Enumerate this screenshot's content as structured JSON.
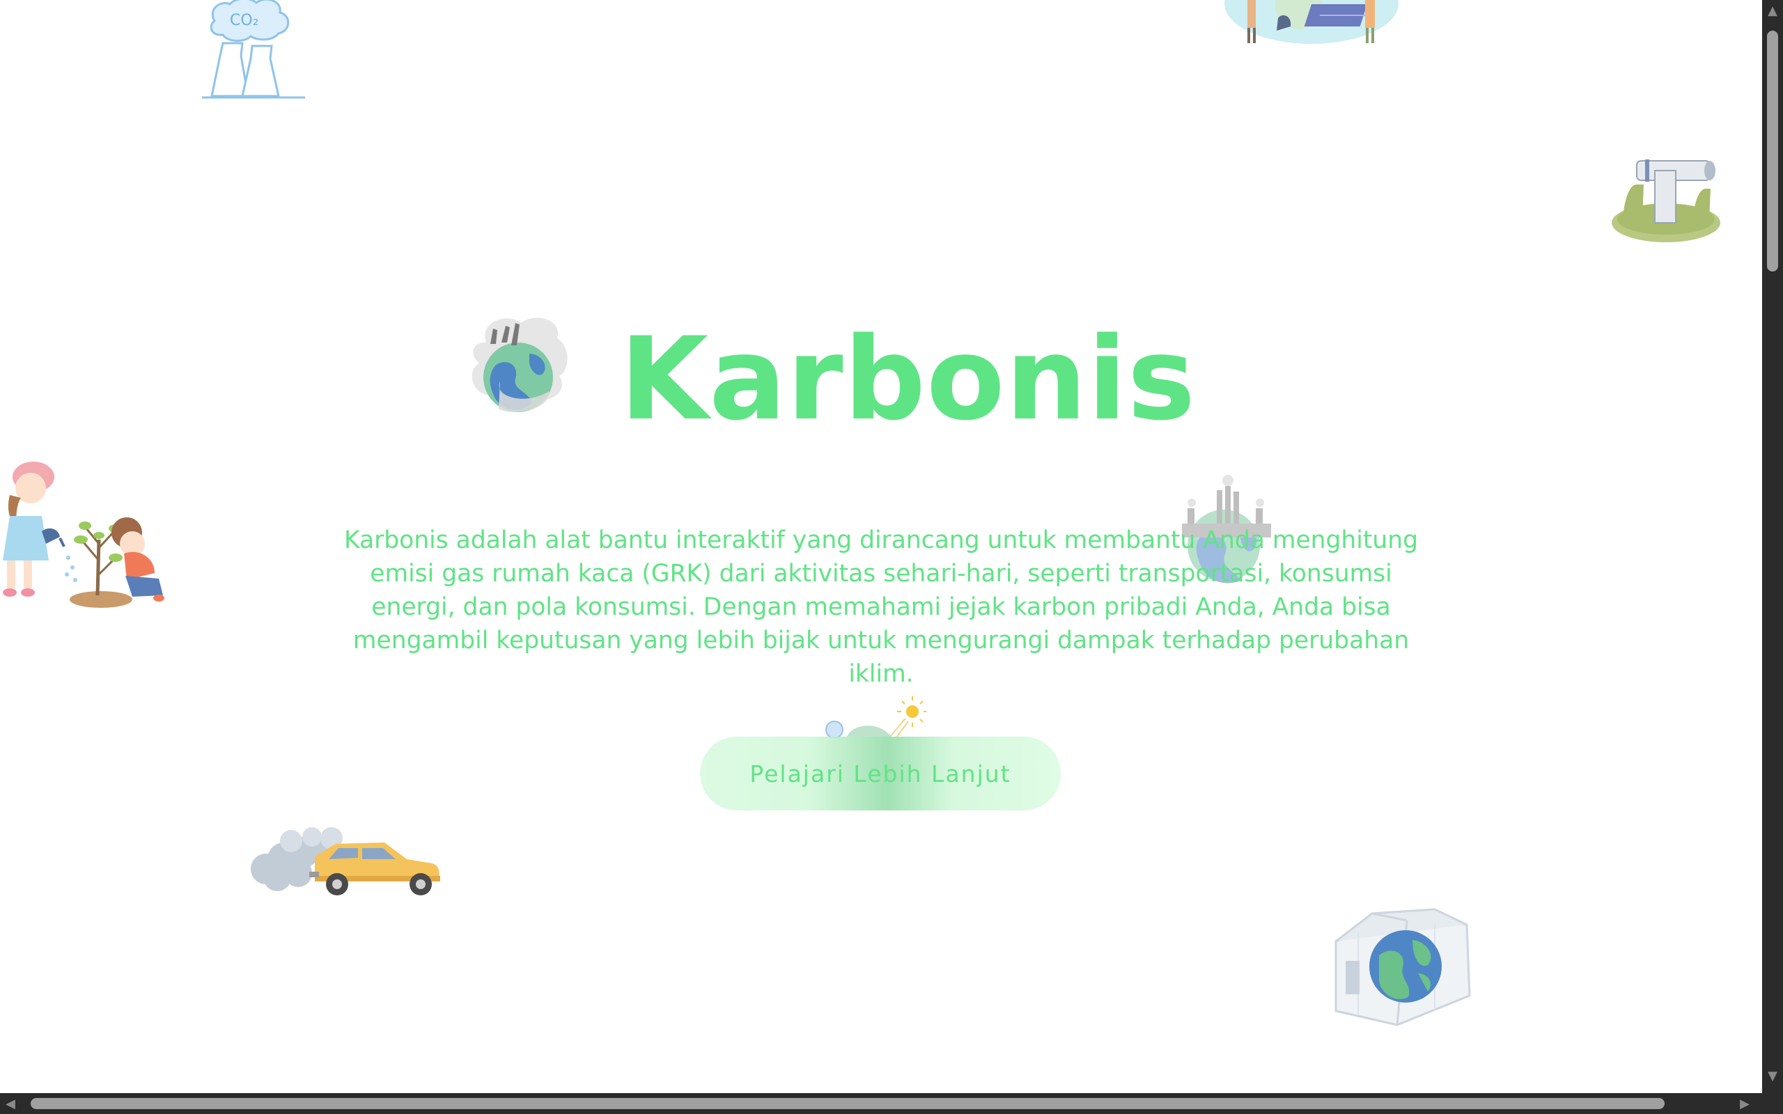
{
  "hero": {
    "title": "Karbonis",
    "description": "Karbonis adalah alat bantu interaktif yang dirancang untuk membantu Anda menghitung emisi gas rumah kaca (GRK) dari aktivitas sehari-hari, seperti transportasi, konsumsi energi, dan pola konsumsi. Dengan memahami jejak karbon pribadi Anda, Anda bisa mengambil keputusan yang lebih bijak untuk mengurangi dampak terhadap perubahan iklim.",
    "cta_label": "Pelajari Lebih Lanjut"
  },
  "illustrations": {
    "co2_label": "CO₂"
  },
  "scrollbars": {
    "up_glyph": "▲",
    "down_glyph": "▼",
    "left_glyph": "◀",
    "right_glyph": "▶"
  },
  "colors": {
    "accent": "#5fe485",
    "background": "#ffffff",
    "scrollbar_track": "#2b2b2b",
    "scrollbar_thumb": "#a0a0a0"
  }
}
